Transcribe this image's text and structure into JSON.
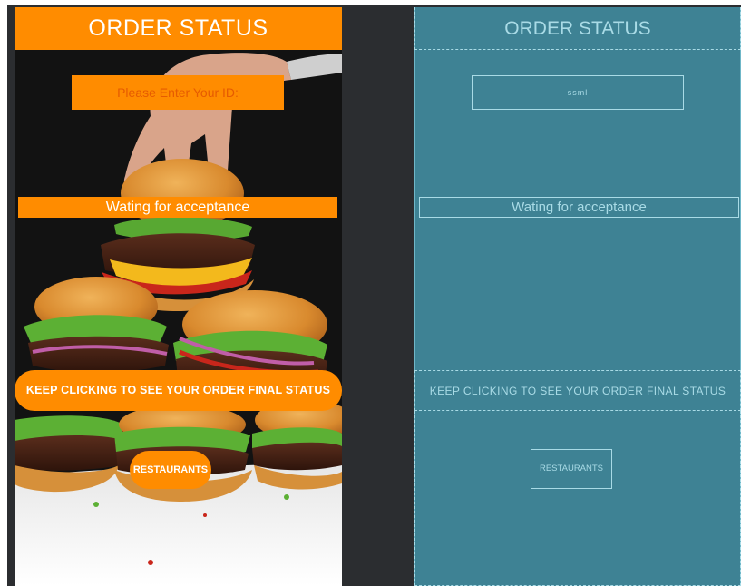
{
  "design_view": {
    "title": "ORDER STATUS",
    "id_input": {
      "placeholder": "Please Enter Your ID:",
      "value": ""
    },
    "status_text": "Wating for acceptance",
    "refresh_button_label": "KEEP CLICKING TO SEE YOUR ORDER FINAL STATUS",
    "restaurants_button_label": "RESTAURANTS"
  },
  "blueprint_view": {
    "title": "ORDER STATUS",
    "id_input_text": "ssml",
    "status_text": "Wating for acceptance",
    "refresh_button_label": "KEEP CLICKING TO SEE YOUR ORDER FINAL STATUS",
    "restaurants_button_label": "RESTAURANTS"
  },
  "colors": {
    "accent": "#ff8c00",
    "blueprint_background": "#3e8294",
    "blueprint_outline": "#a9dbe6",
    "workspace_background": "#2b2d30"
  },
  "icons": {
    "background_image": "burger-stack-photo"
  }
}
